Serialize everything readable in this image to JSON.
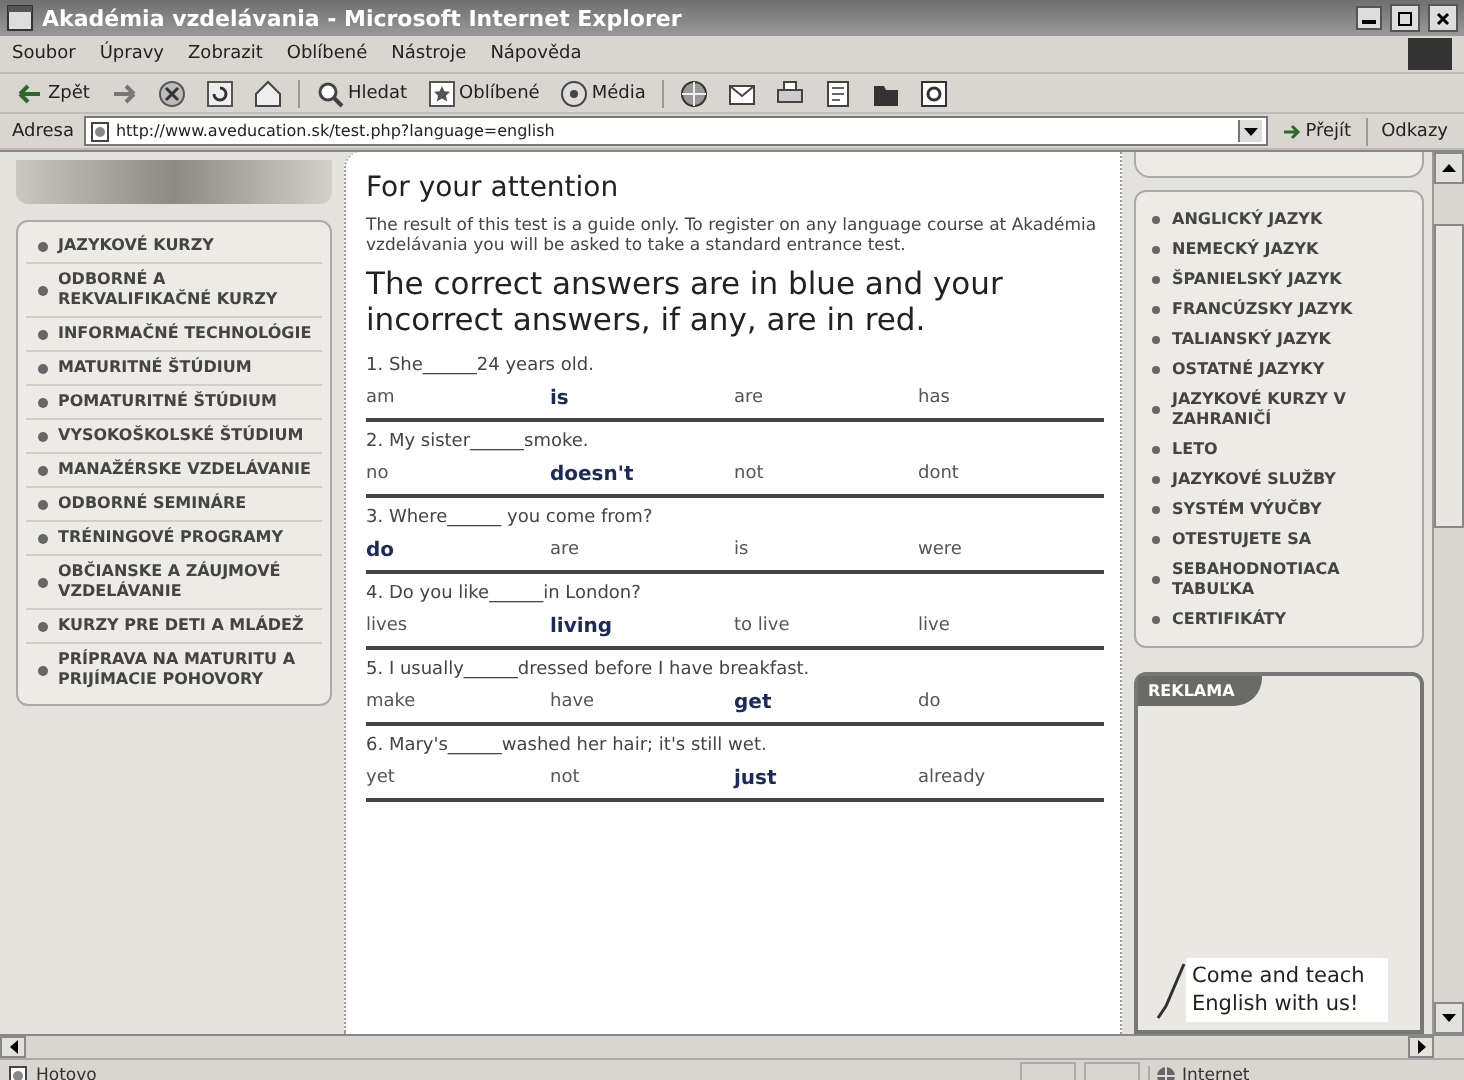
{
  "window": {
    "title": "Akadémia vzdelávania - Microsoft Internet Explorer"
  },
  "menu": [
    "Soubor",
    "Úpravy",
    "Zobrazit",
    "Oblíbené",
    "Nástroje",
    "Nápověda"
  ],
  "toolbar": [
    {
      "kind": "back",
      "label": "Zpět"
    },
    {
      "kind": "forward"
    },
    {
      "kind": "stop"
    },
    {
      "kind": "refresh"
    },
    {
      "kind": "home"
    },
    {
      "kind": "search",
      "label": "Hledat"
    },
    {
      "kind": "favorites",
      "label": "Oblíbené"
    },
    {
      "kind": "media",
      "label": "Média"
    },
    {
      "kind": "history"
    },
    {
      "kind": "mail"
    },
    {
      "kind": "print"
    },
    {
      "kind": "edit"
    },
    {
      "kind": "discuss"
    },
    {
      "kind": "messenger"
    }
  ],
  "address": {
    "label": "Adresa",
    "url": "http://www.aveducation.sk/test.php?language=english",
    "go": "Přejít",
    "links": "Odkazy"
  },
  "left_nav": [
    "JAZYKOVÉ KURZY",
    "ODBORNÉ A REKVALIFIKAČNÉ KURZY",
    "INFORMAČNÉ TECHNOLÓGIE",
    "MATURITNÉ ŠTÚDIUM",
    "POMATURITNÉ ŠTÚDIUM",
    "VYSOKOŠKOLSKÉ ŠTÚDIUM",
    "MANAŽÉRSKE VZDELÁVANIE",
    "ODBORNÉ SEMINÁRE",
    "TRÉNINGOVÉ PROGRAMY",
    "OBČIANSKE A ZÁUJMOVÉ VZDELÁVANIE",
    "KURZY PRE DETI A MLÁDEŽ",
    "PRÍPRAVA NA MATURITU A PRIJÍMACIE POHOVORY"
  ],
  "main": {
    "heading": "For your attention",
    "note": "The result of this test is a guide only. To register on any language course at Akadémia vzdelávania you will be asked to take a standard entrance test.",
    "instruction": "The correct answers are in blue and your incorrect answers, if any, are in red.",
    "questions": [
      {
        "text": "1. She______24 years old.",
        "options": [
          {
            "text": "am",
            "correct": false
          },
          {
            "text": "is",
            "correct": true
          },
          {
            "text": "are",
            "correct": false
          },
          {
            "text": "has",
            "correct": false
          }
        ]
      },
      {
        "text": "2. My sister______smoke.",
        "options": [
          {
            "text": "no",
            "correct": false
          },
          {
            "text": "doesn't",
            "correct": true
          },
          {
            "text": "not",
            "correct": false
          },
          {
            "text": "dont",
            "correct": false
          }
        ]
      },
      {
        "text": "3. Where______ you come from?",
        "options": [
          {
            "text": "do",
            "correct": true
          },
          {
            "text": "are",
            "correct": false
          },
          {
            "text": "is",
            "correct": false
          },
          {
            "text": "were",
            "correct": false
          }
        ]
      },
      {
        "text": "4. Do you like______in London?",
        "options": [
          {
            "text": "lives",
            "correct": false
          },
          {
            "text": "living",
            "correct": true
          },
          {
            "text": "to live",
            "correct": false
          },
          {
            "text": "live",
            "correct": false
          }
        ]
      },
      {
        "text": "5. I usually______dressed before I have breakfast.",
        "options": [
          {
            "text": "make",
            "correct": false
          },
          {
            "text": "have",
            "correct": false
          },
          {
            "text": "get",
            "correct": true
          },
          {
            "text": "do",
            "correct": false
          }
        ]
      },
      {
        "text": "6. Mary's______washed her hair; it's still wet.",
        "options": [
          {
            "text": "yet",
            "correct": false
          },
          {
            "text": "not",
            "correct": false
          },
          {
            "text": "just",
            "correct": true
          },
          {
            "text": "already",
            "correct": false
          }
        ]
      }
    ]
  },
  "right_nav": [
    "ANGLICKÝ JAZYK",
    "NEMECKÝ JAZYK",
    "ŠPANIELSKÝ JAZYK",
    "FRANCÚZSKY JAZYK",
    "TALIANSKÝ JAZYK",
    "OSTATNÉ JAZYKY",
    "JAZYKOVÉ KURZY V ZAHRANIČÍ",
    "LETO",
    "JAZYKOVÉ SLUŽBY",
    "SYSTÉM VÝUČBY",
    "OTESTUJETE SA",
    "SEBAHODNOTIACA TABUĽKA",
    "CERTIFIKÁTY"
  ],
  "ad": {
    "label": "REKLAMA",
    "text": "Come and teach English with us!"
  },
  "status": {
    "text": "Hotovo",
    "zone": "Internet"
  }
}
